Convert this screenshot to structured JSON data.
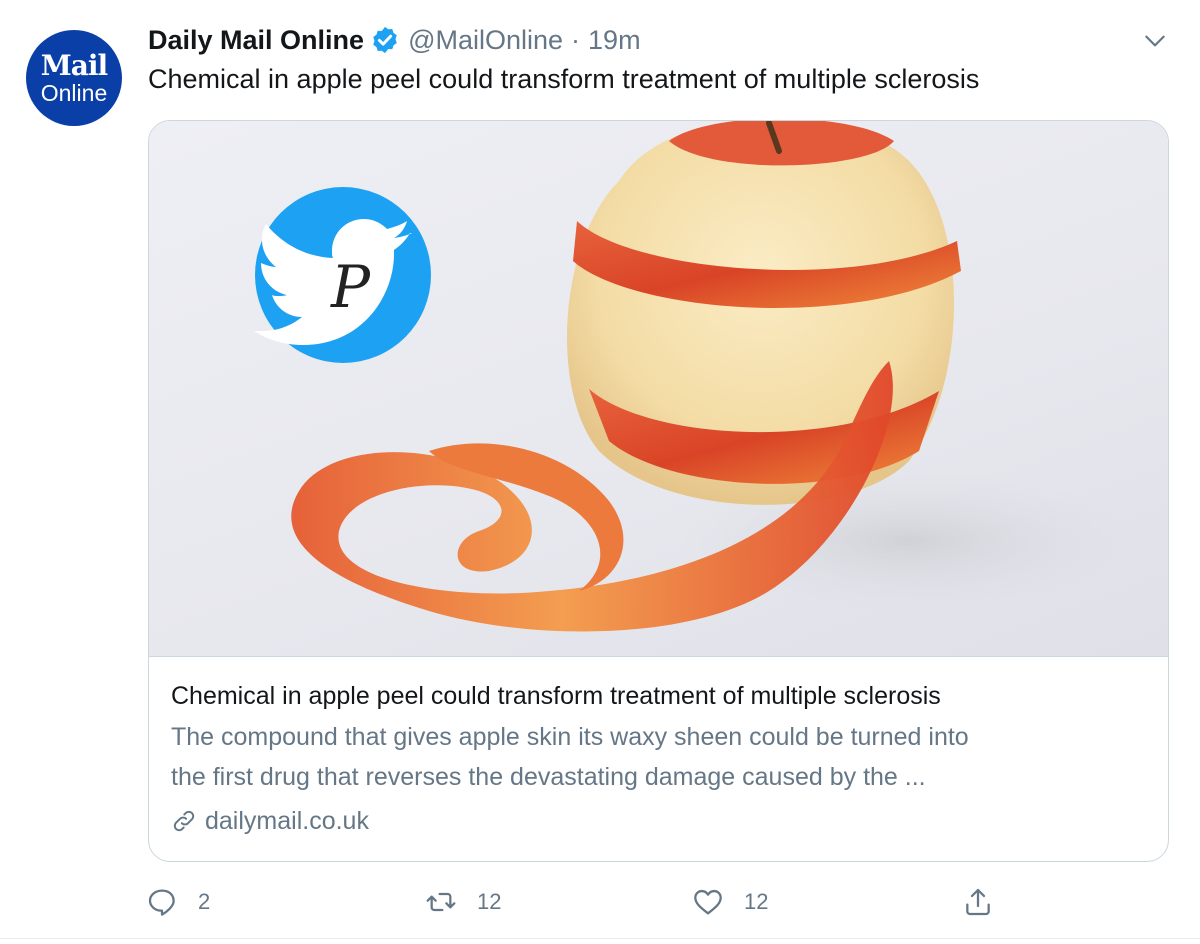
{
  "tweet": {
    "author_name": "Daily Mail Online",
    "verified": true,
    "handle": "@MailOnline",
    "separator": "·",
    "time": "19m",
    "text": "Chemical in apple peel could transform treatment of multiple sclerosis",
    "avatar": {
      "line1": "Mail",
      "line2": "Online",
      "color": "#0b3fa8"
    }
  },
  "card": {
    "image_icon": "peeled-apple-image",
    "watermark_icon": "twitter-bird-p-watermark",
    "title": "Chemical in apple peel could transform treatment of multiple sclerosis",
    "description_line1": "The compound that gives apple skin its waxy sheen could be turned into",
    "description_line2": "the first drug that reverses the devastating damage caused by the ...",
    "domain": "dailymail.co.uk"
  },
  "actions": {
    "reply_count": "2",
    "retweet_count": "12",
    "like_count": "12"
  },
  "colors": {
    "accent": "#1da1f2",
    "muted_text": "#657786",
    "border": "#ccd6dd"
  }
}
